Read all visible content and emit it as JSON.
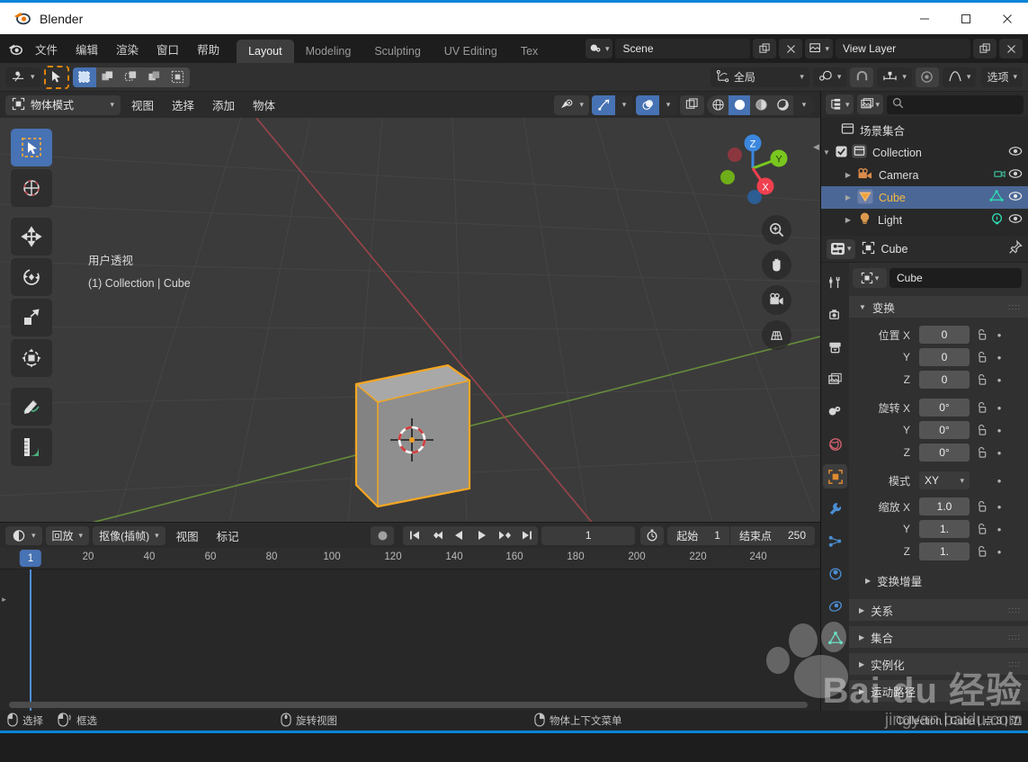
{
  "window": {
    "title": "Blender",
    "logo_icon": "blender-logo-icon",
    "minimize_label": "—",
    "maximize_label": "☐",
    "close_label": "✕"
  },
  "topbar": {
    "logo_icon": "blender-logo-icon",
    "menus": [
      "文件",
      "编辑",
      "渲染",
      "窗口",
      "帮助"
    ],
    "workspace_tabs": [
      {
        "label": "Layout",
        "active": true
      },
      {
        "label": "Modeling",
        "active": false
      },
      {
        "label": "Sculpting",
        "active": false
      },
      {
        "label": "UV Editing",
        "active": false
      },
      {
        "label": "Tex",
        "active": false
      }
    ],
    "scene_icon": "scene-icon",
    "scene_name": "Scene",
    "new_scene_icon": "duplicate-icon",
    "remove_scene_icon": "x-icon",
    "viewlayer_icon": "view-layer-icon",
    "viewlayer_name": "View Layer",
    "viewlayer_new_icon": "duplicate-icon",
    "viewlayer_remove_icon": "x-icon"
  },
  "tool_header": {
    "editor_type_icon": "editor-type-icon",
    "cursor_tool_icon": "cursor-arrow-icon",
    "select_modes": [
      "set-select-icon",
      "extend-select-icon",
      "subtract-select-icon",
      "invert-select-icon",
      "intersect-select-icon"
    ],
    "transform_orientation_icon": "orientation-icon",
    "transform_orientation": "全局",
    "pivot_icon": "pivot-icon",
    "snap_magnet_icon": "magnet-icon",
    "snap_icon": "snap-increment-icon",
    "proportional_icon": "proportional-edit-icon",
    "falloff_icon": "falloff-curve-icon",
    "options_label": "选项"
  },
  "viewport_header": {
    "mode_icon": "object-mode-icon",
    "mode_label": "物体模式",
    "menus": [
      "视图",
      "选择",
      "添加",
      "物体"
    ],
    "visibility_icon": "visibility-eye-icon",
    "gizmo_icon": "gizmo-icon",
    "overlays_icon": "overlays-icon",
    "xray_icon": "xray-toggle-icon",
    "shading_modes": [
      "wireframe-icon",
      "solid-icon",
      "material-preview-icon",
      "rendered-icon"
    ],
    "shading_active_index": 1
  },
  "viewport": {
    "view_label": "用户透视",
    "object_path": "(1) Collection | Cube",
    "toolbar_tools": [
      {
        "icon": "select-box-icon",
        "name": "tweak-select-tool",
        "active": true
      },
      {
        "icon": "cursor-3d-icon",
        "name": "cursor-tool",
        "active": false
      },
      {
        "icon": "move-icon",
        "name": "move-tool",
        "active": false
      },
      {
        "icon": "rotate-icon",
        "name": "rotate-tool",
        "active": false
      },
      {
        "icon": "scale-icon",
        "name": "scale-tool",
        "active": false
      },
      {
        "icon": "transform-icon",
        "name": "transform-tool",
        "active": false
      },
      {
        "icon": "annotate-icon",
        "name": "annotate-tool",
        "active": false
      },
      {
        "icon": "measure-icon",
        "name": "measure-tool",
        "active": false
      }
    ],
    "gizmo_axes": [
      {
        "label": "Z",
        "color": "#3b87dd"
      },
      {
        "label": "Y",
        "color": "#79c71f"
      },
      {
        "label": "X",
        "color": "#f0404f"
      }
    ],
    "nav_buttons": [
      "zoom-icon",
      "pan-hand-icon",
      "camera-view-icon",
      "ortho-persp-icon"
    ],
    "colors": {
      "background": "#3b3b3b",
      "grid_line": "#4a4a4a",
      "x_axis": "#a6464c",
      "y_axis": "#6e9c3a",
      "cube_face_light": "#a3a3a3",
      "cube_face_mid": "#8d8d8d",
      "cube_face_dark": "#7b7b7b",
      "cube_outline": "#f5a623"
    }
  },
  "outliner": {
    "display_mode_icon": "outliner-display-icon",
    "filter_icon": "filter-images-icon",
    "search_icon": "search-icon",
    "search_placeholder": "",
    "root_icon": "scene-collection-icon",
    "root_label": "场景集合",
    "rows": [
      {
        "label": "Collection",
        "icon": "collection-icon",
        "indent": 1,
        "disclosure": "▼",
        "checkbox": true,
        "selected": false,
        "eye_icon": "eye-icon",
        "data_icon": ""
      },
      {
        "label": "Camera",
        "icon": "camera-data-icon",
        "indent": 2,
        "disclosure": "▶",
        "checkbox": false,
        "selected": false,
        "eye_icon": "eye-icon",
        "data_icon": "camera-obj-icon"
      },
      {
        "label": "Cube",
        "icon": "mesh-object-icon",
        "indent": 2,
        "disclosure": "▶",
        "checkbox": false,
        "selected": true,
        "eye_icon": "eye-icon",
        "data_icon": "mesh-data-icon"
      },
      {
        "label": "Light",
        "icon": "light-object-icon",
        "indent": 2,
        "disclosure": "▶",
        "checkbox": false,
        "selected": false,
        "eye_icon": "eye-icon",
        "data_icon": "light-data-icon"
      }
    ]
  },
  "properties": {
    "editor_icon": "properties-editor-icon",
    "breadcrumb_icon": "object-icon",
    "breadcrumb": "Cube",
    "pin_icon": "pin-icon",
    "tabs": [
      {
        "icon": "tool-icon",
        "name": "tool",
        "active": false
      },
      {
        "icon": "render-icon",
        "name": "render",
        "active": false
      },
      {
        "icon": "output-icon",
        "name": "output",
        "active": false
      },
      {
        "icon": "viewlayer-icon",
        "name": "view-layer",
        "active": false
      },
      {
        "icon": "scene-props-icon",
        "name": "scene",
        "active": false
      },
      {
        "icon": "world-icon",
        "name": "world",
        "active": false
      },
      {
        "icon": "object-props-icon",
        "name": "object",
        "active": true
      },
      {
        "icon": "modifier-wrench-icon",
        "name": "modifiers",
        "active": false
      },
      {
        "icon": "particles-icon",
        "name": "particles",
        "active": false
      },
      {
        "icon": "physics-icon",
        "name": "physics",
        "active": false
      },
      {
        "icon": "constraints-icon",
        "name": "constraints",
        "active": false
      },
      {
        "icon": "mesh-data-icon",
        "name": "object-data",
        "active": false
      }
    ],
    "id_icon": "object-icon",
    "object_name": "Cube",
    "transform_panel": {
      "title": "变换",
      "location_label": "位置",
      "rotation_label": "旋转",
      "scale_label": "缩放",
      "mode_label": "模式",
      "mode_value": "XY",
      "axes": [
        "X",
        "Y",
        "Z"
      ],
      "location": [
        "0",
        "0",
        "0"
      ],
      "rotation": [
        "0°",
        "0°",
        "0°"
      ],
      "scale": [
        "1.0",
        "1.",
        "1."
      ],
      "lock_icon": "unlocked-icon",
      "anim_icon": "animate-dot-icon"
    },
    "sub_panels": [
      {
        "label": "变换增量",
        "sub": true
      },
      {
        "label": "关系",
        "sub": false
      },
      {
        "label": "集合",
        "sub": false
      },
      {
        "label": "实例化",
        "sub": false
      },
      {
        "label": "运动路径",
        "sub": false
      }
    ]
  },
  "timeline": {
    "editor_icon": "timeline-editor-icon",
    "menus_dd": [
      "回放",
      "抠像(插帧)"
    ],
    "menus": [
      "视图",
      "标记"
    ],
    "record_icon": "record-keyframe-icon",
    "playback_buttons": [
      "jump-start-icon",
      "prev-keyframe-icon",
      "play-reverse-icon",
      "play-icon",
      "next-keyframe-icon",
      "jump-end-icon"
    ],
    "current_frame": "1",
    "use_preview_range_icon": "stopwatch-icon",
    "start_label": "起始",
    "start_value": "1",
    "end_label": "结束点",
    "end_value": "250",
    "ruler_ticks": [
      "20",
      "40",
      "60",
      "80",
      "100",
      "120",
      "140",
      "160",
      "180",
      "200",
      "220",
      "240"
    ],
    "playhead_frame": "1"
  },
  "statusbar": {
    "items": [
      {
        "icon": "mouse-left-icon",
        "label": "选择"
      },
      {
        "icon": "mouse-drag-icon",
        "label": "框选"
      },
      {
        "icon": "mouse-middle-icon",
        "label": "旋转视图"
      },
      {
        "icon": "mouse-right-icon",
        "label": "物体上下文菜单"
      }
    ],
    "scene_stats": "Collection | Cube | 点:8 | 边"
  },
  "watermark": {
    "main": "Bai du 经验",
    "sub": "jingyan.baidu.com"
  }
}
